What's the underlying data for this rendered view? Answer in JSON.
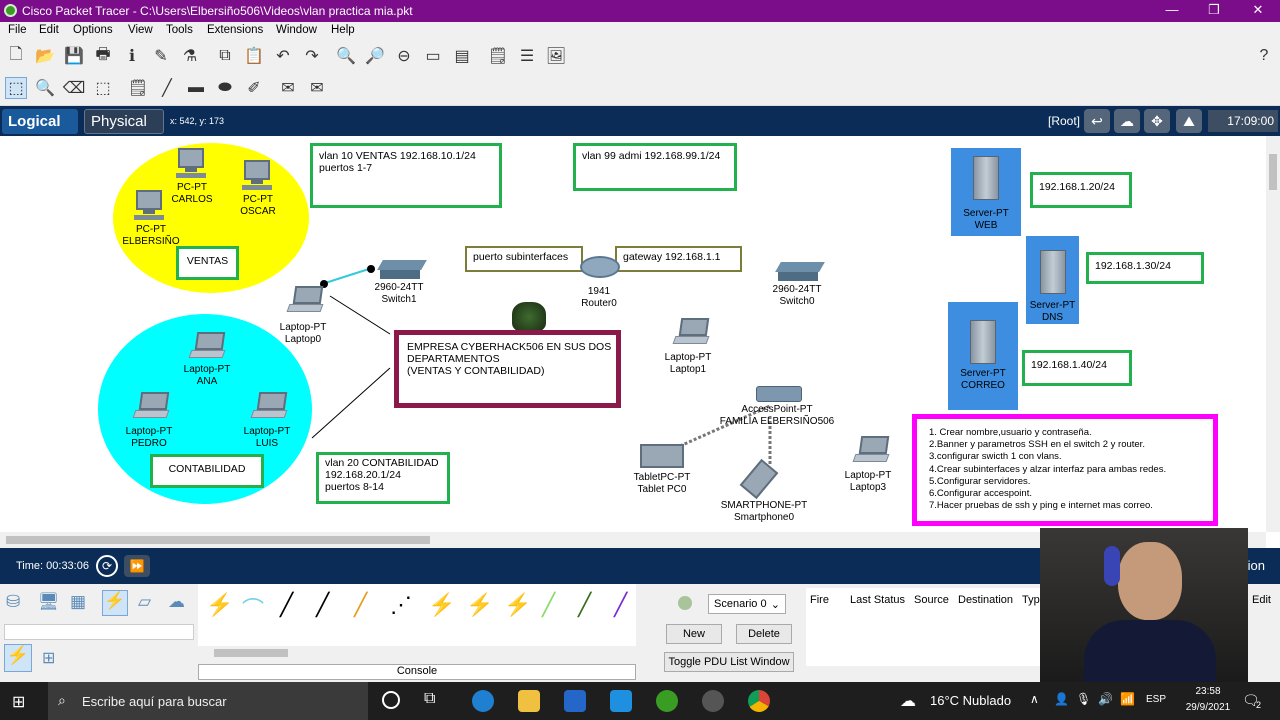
{
  "title_bar": {
    "title": "Cisco Packet Tracer - C:\\Users\\Elbersiño506\\Videos\\vlan practica mia.pkt",
    "minimize": "—",
    "maximize": "❐",
    "close": "✕"
  },
  "menu": [
    "File",
    "Edit",
    "Options",
    "View",
    "Tools",
    "Extensions",
    "Window",
    "Help"
  ],
  "help_icon": "?",
  "mode_tabs": {
    "logical": "Logical",
    "physical": "Physical"
  },
  "cursor_coords": "x: 542, y: 173",
  "root_label": "[Root]",
  "clock": "17:09:00",
  "workspace": {
    "ventas_devices": [
      "PC-PT\nCARLOS",
      "PC-PT\nOSCAR",
      "PC-PT\nELBERSIÑO"
    ],
    "ventas_label": "VENTAS",
    "contabilidad_devices": [
      "Laptop-PT\nANA",
      "Laptop-PT\nPEDRO",
      "Laptop-PT\nLUIS"
    ],
    "contabilidad_label": "CONTABILIDAD",
    "vlan10_note": "vlan 10 VENTAS 192.168.10.1/24\npuertos 1-7",
    "vlan99_note": "vlan 99 admi 192.168.99.1/24",
    "vlan20_note": "vlan 20 CONTABILIDAD\n192.168.20.1/24\npuertos 8-14",
    "subinterfaces_note": "puerto subinterfaces",
    "gateway_note": "gateway 192.168.1.1",
    "switch1": "2960-24TT\nSwitch1",
    "switch0": "2960-24TT\nSwitch0",
    "router": "1941\nRouter0",
    "laptop0": "Laptop-PT\nLaptop0",
    "laptop1": "Laptop-PT\nLaptop1",
    "laptop3": "Laptop-PT\nLaptop3",
    "company_note": "EMPRESA CYBERHACK506 EN SUS DOS\nDEPARTAMENTOS\n(VENTAS Y CONTABILIDAD)",
    "access_point": "AccessPoint-PT\nFAMILIA ELBERSIÑO506",
    "tablet": "TabletPC-PT\nTablet PC0",
    "smartphone": "SMARTPHONE-PT\nSmartphone0",
    "server_web": "Server-PT\nWEB",
    "server_dns": "Server-PT\nDNS",
    "server_correo": "Server-PT\nCORREO",
    "ip_web": "192.168.1.20/24",
    "ip_dns": "192.168.1.30/24",
    "ip_correo": "192.168.1.40/24",
    "tasks": [
      "1. Crear nombre,usuario y contraseña.",
      "2.Banner y parametros SSH en el switch 2 y router.",
      "3.configurar swicth 1 con vlans.",
      "4.Crear subinterfaces y alzar interfaz para ambas redes.",
      "5.Configurar servidores.",
      "6.Configurar accespoint.",
      "7.Hacer pruebas de ssh y ping e internet mas correo."
    ]
  },
  "bottom": {
    "time": "Time: 00:33:06",
    "scenario": "Scenario 0",
    "new_btn": "New",
    "delete_btn": "Delete",
    "toggle_btn": "Toggle PDU List Window",
    "console": "Console",
    "columns": [
      "Fire",
      "Last Status",
      "Source",
      "Destination",
      "Typ"
    ],
    "edit": "Edit",
    "tion": "tion"
  },
  "taskbar": {
    "search": "Escribe aquí para buscar",
    "weather": "16°C  Nublado",
    "lang": "ESP",
    "time": "23:58",
    "date": "29/9/2021",
    "notif": "2"
  },
  "colors": {
    "title_bar": "#7b0d8a",
    "mode_bar": "#0a2c57",
    "ventas_zone": "#ffff00",
    "contabilidad_zone": "#00ffff",
    "note_border": "#22b14c",
    "company_border": "#8b1a4a",
    "tasks_border": "#ff00ff",
    "server_panel": "#3d8ee0"
  }
}
